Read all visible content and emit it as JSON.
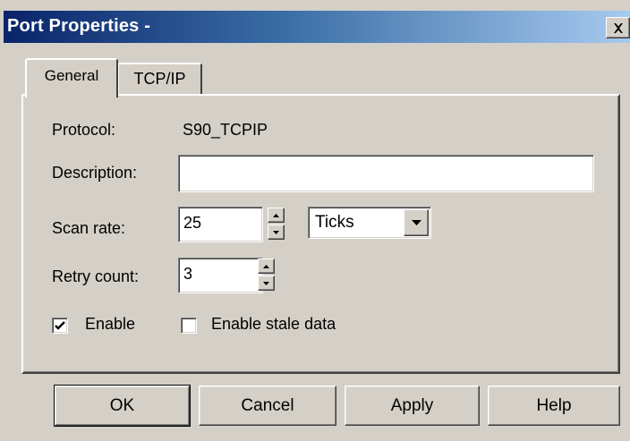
{
  "window": {
    "title": "Port Properties -",
    "close_icon": "close-icon"
  },
  "tabs": [
    {
      "label": "General",
      "selected": true
    },
    {
      "label": "TCP/IP",
      "selected": false
    }
  ],
  "general": {
    "protocol_label": "Protocol:",
    "protocol_value": "S90_TCPIP",
    "description_label": "Description:",
    "description_value": "",
    "scan_rate_label": "Scan rate:",
    "scan_rate_value": "25",
    "scan_rate_unit": "Ticks",
    "retry_count_label": "Retry count:",
    "retry_count_value": "3",
    "enable_label": "Enable",
    "enable_checked": true,
    "stale_label": "Enable stale data",
    "stale_checked": false
  },
  "buttons": {
    "ok": "OK",
    "cancel": "Cancel",
    "apply": "Apply",
    "help": "Help"
  },
  "colors": {
    "face": "#d4d0c8",
    "title_start": "#0a246a",
    "title_end": "#a6caf0"
  }
}
